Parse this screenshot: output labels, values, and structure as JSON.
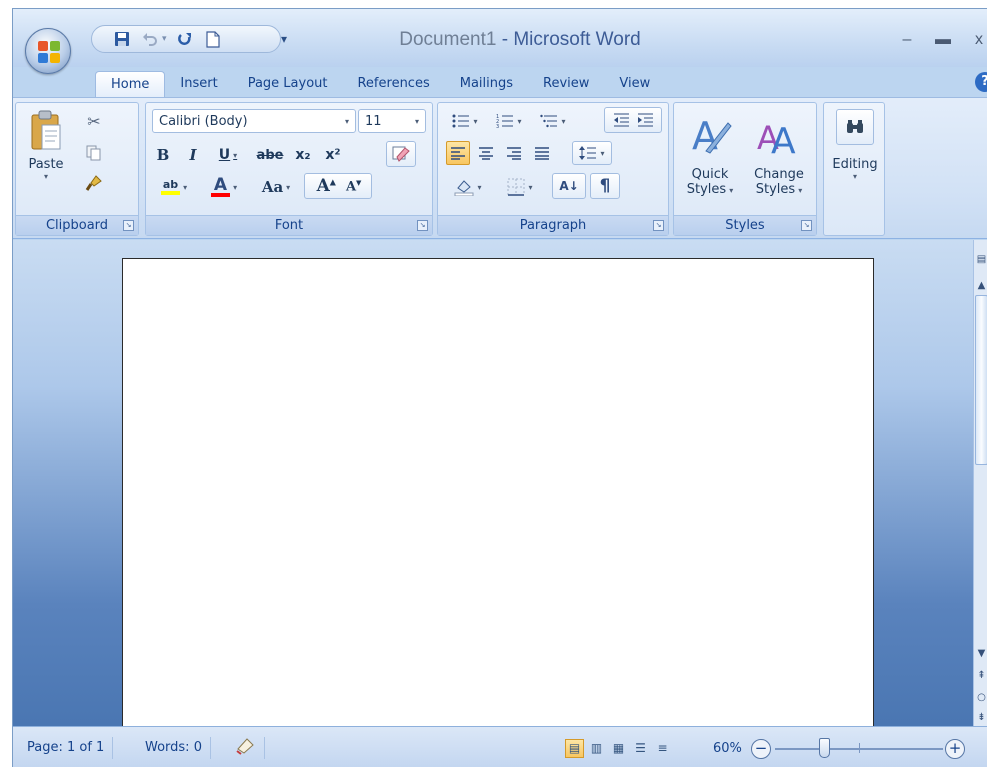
{
  "title_bar": {
    "document_name": "Document1",
    "app_name": "- Microsoft Word",
    "qat_customize": "▾"
  },
  "tabs": [
    {
      "label": "Home",
      "active": true
    },
    {
      "label": "Insert"
    },
    {
      "label": "Page Layout"
    },
    {
      "label": "References"
    },
    {
      "label": "Mailings"
    },
    {
      "label": "Review"
    },
    {
      "label": "View"
    }
  ],
  "ribbon": {
    "clipboard": {
      "label": "Clipboard",
      "paste_label": "Paste"
    },
    "font": {
      "label": "Font",
      "font_name": "Calibri (Body)",
      "font_size": "11",
      "bold": "B",
      "italic": "I",
      "underline": "U",
      "strikethrough": "abe",
      "subscript": "x₂",
      "superscript": "x²",
      "change_case": "Aa",
      "grow_font": "A",
      "shrink_font": "A",
      "highlight": "ab",
      "font_color": "A"
    },
    "paragraph": {
      "label": "Paragraph",
      "sort": "A↓",
      "show_marks": "¶"
    },
    "styles": {
      "label": "Styles",
      "quick_styles_line1": "Quick",
      "quick_styles_line2": "Styles",
      "change_styles_line1": "Change",
      "change_styles_line2": "Styles"
    },
    "editing": {
      "label": "Editing"
    }
  },
  "status_bar": {
    "page": "Page: 1 of 1",
    "words": "Words: 0",
    "zoom": "60%"
  },
  "colors": {
    "title_blue": "#3d5c96",
    "tab_text": "#15428b",
    "highlight_yellow": "#ffff00",
    "font_color_red": "#ff0000"
  }
}
